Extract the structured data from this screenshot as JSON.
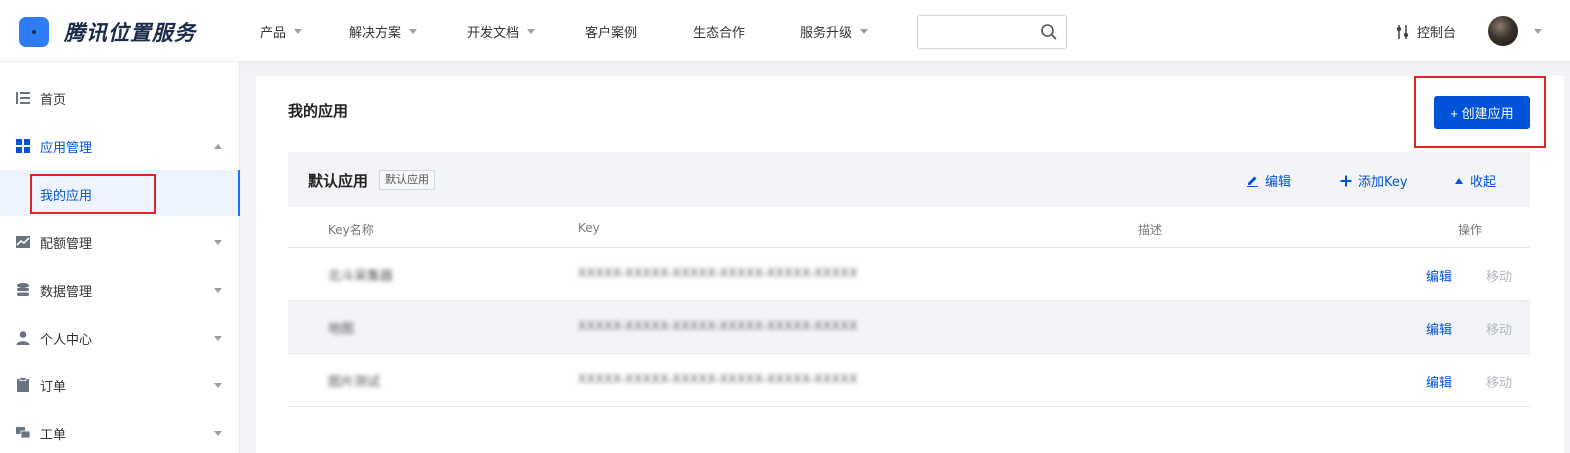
{
  "brand": {
    "name": "腾讯位置服务"
  },
  "nav": [
    {
      "label": "产品",
      "has_caret": true
    },
    {
      "label": "解决方案",
      "has_caret": true
    },
    {
      "label": "开发文档",
      "has_caret": true
    },
    {
      "label": "客户案例",
      "has_caret": false
    },
    {
      "label": "生态合作",
      "has_caret": false
    },
    {
      "label": "服务升级",
      "has_caret": true
    }
  ],
  "search": {
    "placeholder": "",
    "icon": "search-icon"
  },
  "console": {
    "label": "控制台",
    "icon": "sliders-icon"
  },
  "sidebar": {
    "items": [
      {
        "label": "首页",
        "icon": "list-icon"
      },
      {
        "label": "应用管理",
        "icon": "grid-icon",
        "active": true
      },
      {
        "label": "我的应用",
        "sub": true
      },
      {
        "label": "配额管理",
        "icon": "chart-icon"
      },
      {
        "label": "数据管理",
        "icon": "database-icon"
      },
      {
        "label": "个人中心",
        "icon": "user-icon"
      },
      {
        "label": "订单",
        "icon": "clipboard-icon"
      },
      {
        "label": "工单",
        "icon": "chat-icon"
      }
    ]
  },
  "main": {
    "title": "我的应用",
    "create_button": "+ 创建应用",
    "app": {
      "name": "默认应用",
      "tag": "默认应用",
      "actions": {
        "edit": "编辑",
        "add_key": "添加Key",
        "collapse": "收起"
      }
    },
    "table": {
      "headers": {
        "name": "Key名称",
        "key": "Key",
        "desc": "描述",
        "ops": "操作"
      },
      "rows": [
        {
          "name": "北斗采集器",
          "key": "XXXXX-XXXXX-XXXXX-XXXXX-XXXXX-XXXXX",
          "edit": "编辑",
          "move": "移动"
        },
        {
          "name": "地图",
          "key": "XXXXX-XXXXX-XXXXX-XXXXX-XXXXX-XXXXX",
          "edit": "编辑",
          "move": "移动"
        },
        {
          "name": "图片测试",
          "key": "XXXXX-XXXXX-XXXXX-XXXXX-XXXXX-XXXXX",
          "edit": "编辑",
          "move": "移动"
        }
      ]
    }
  },
  "colors": {
    "primary": "#0052d9",
    "highlight_box": "#e02424"
  }
}
